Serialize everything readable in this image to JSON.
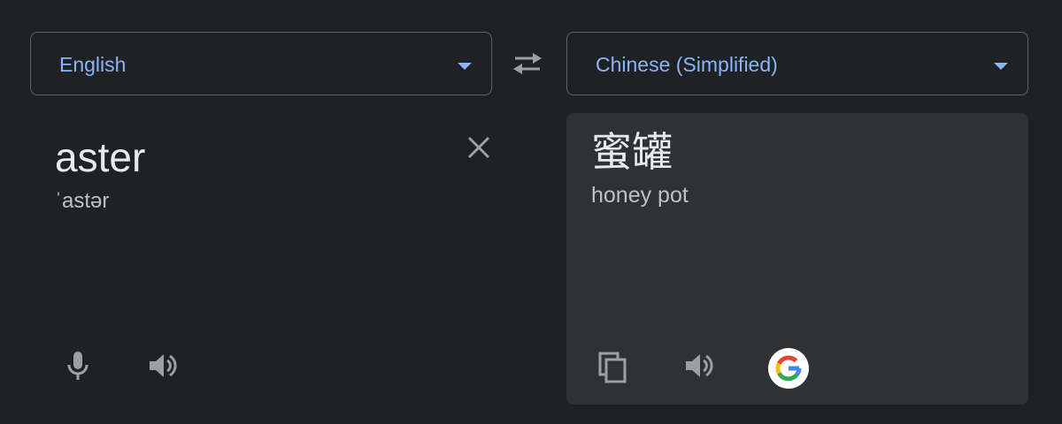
{
  "source_language": {
    "label": "English"
  },
  "target_language": {
    "label": "Chinese (Simplified)"
  },
  "source": {
    "text": "aster",
    "phonetic": "ˈastər"
  },
  "target": {
    "text": "蜜罐",
    "romanization": "honey pot"
  },
  "icons": {
    "source_dropdown": "chevron-down-icon",
    "target_dropdown": "chevron-down-icon",
    "swap": "swap-languages-icon",
    "clear": "close-icon",
    "microphone": "microphone-icon",
    "source_listen": "speaker-icon",
    "copy": "copy-icon",
    "target_listen": "speaker-icon",
    "google": "google-g-icon"
  },
  "colors": {
    "background": "#202124",
    "output_panel": "#303134",
    "accent": "#8ab4f8",
    "primary_text": "#e8eaed",
    "secondary_text": "#bdc1c6",
    "icon": "#9aa0a6"
  }
}
